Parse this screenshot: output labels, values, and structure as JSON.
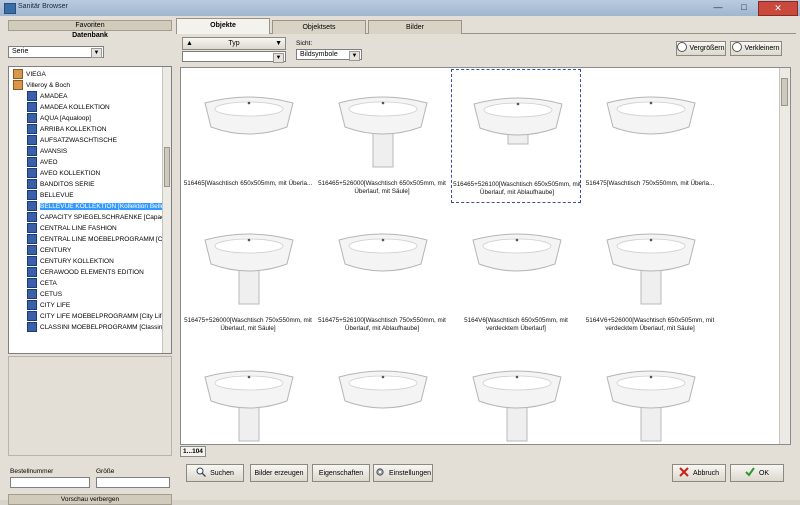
{
  "window": {
    "title": "Sanitär Browser",
    "min": "—",
    "max": "□",
    "close": "✕"
  },
  "colors": {
    "accent": "#3399ff",
    "selection_border": "#3a4ea0",
    "close_red": "#c94a3c"
  },
  "left": {
    "favorites_label": "Favoriten",
    "database_label": "Datenbank",
    "serie_select": "Serie",
    "tree_items": [
      {
        "label": "VIEGA",
        "icon": "lock-icon",
        "level": 0
      },
      {
        "label": "Villeroy & Boch",
        "icon": "lock-icon",
        "level": 0
      },
      {
        "label": "AMADEA",
        "icon": "folder-icon",
        "level": 1
      },
      {
        "label": "AMADEA KOLLEKTION",
        "icon": "folder-icon",
        "level": 1
      },
      {
        "label": "AQUA [Aqualoop]",
        "icon": "folder-icon",
        "level": 1
      },
      {
        "label": "ARRIBA KOLLEKTION",
        "icon": "folder-icon",
        "level": 1
      },
      {
        "label": "AUFSATZWASCHTISCHE",
        "icon": "folder-icon",
        "level": 1
      },
      {
        "label": "AVANSIS",
        "icon": "folder-icon",
        "level": 1
      },
      {
        "label": "AVEO",
        "icon": "folder-icon",
        "level": 1
      },
      {
        "label": "AVEO KOLLEKTION",
        "icon": "folder-icon",
        "level": 1
      },
      {
        "label": "BANDITOS SERIE",
        "icon": "folder-icon",
        "level": 1
      },
      {
        "label": "BELLEVUE",
        "icon": "folder-icon",
        "level": 1
      },
      {
        "label": "BELLEVUE KOLLEKTION [Kollektion Bellevu",
        "icon": "folder-icon",
        "level": 1,
        "selected": true
      },
      {
        "label": "CAPACITY SPIEGELSCHRAENKE [Capacity",
        "icon": "folder-icon",
        "level": 1
      },
      {
        "label": "CENTRAL LINE FASHION",
        "icon": "folder-icon",
        "level": 1
      },
      {
        "label": "CENTRAL LINE MOEBELPROGRAMM [Cent",
        "icon": "folder-icon",
        "level": 1
      },
      {
        "label": "CENTURY",
        "icon": "folder-icon",
        "level": 1
      },
      {
        "label": "CENTURY KOLLEKTION",
        "icon": "folder-icon",
        "level": 1
      },
      {
        "label": "CERAWOOD ELEMENTS EDITION",
        "icon": "folder-icon",
        "level": 1
      },
      {
        "label": "CETA",
        "icon": "folder-icon",
        "level": 1
      },
      {
        "label": "CETUS",
        "icon": "folder-icon",
        "level": 1
      },
      {
        "label": "CITY LIFE",
        "icon": "folder-icon",
        "level": 1
      },
      {
        "label": "CITY LIFE MOEBELPROGRAMM [City Life M",
        "icon": "folder-icon",
        "level": 1
      },
      {
        "label": "CLASSINI MOEBELPROGRAMM [Classini Mo",
        "icon": "folder-icon",
        "level": 1
      }
    ],
    "order_number_label": "Bestellnummer",
    "size_label": "Größe",
    "hide_preview_label": "Vorschau verbergen"
  },
  "tabs": [
    {
      "label": "Objekte",
      "active": true
    },
    {
      "label": "Objektsets",
      "active": false
    },
    {
      "label": "Bilder",
      "active": false
    }
  ],
  "toolbar": {
    "type_label": "Typ",
    "view_label": "Sicht:",
    "view_value": "Bildsymbole",
    "zoom_in_label": "Vergrößern",
    "zoom_out_label": "Verkleinern"
  },
  "items": [
    {
      "caption": "516465[Waschtisch  650x505mm,  mit Überla...",
      "kind": "basin"
    },
    {
      "caption": "516465+526000[Waschtisch 650x505mm, mit Überlauf, mit Säule]",
      "kind": "pedestal"
    },
    {
      "caption": "516465+526100[Waschtisch 650x505mm, mit Überlauf, mit Ablaufhaube]",
      "kind": "semi",
      "selected": true
    },
    {
      "caption": "516475[Waschtisch  750x550mm,  mit Überla...",
      "kind": "basin"
    },
    {
      "caption": "516475+526000[Waschtisch 750x550mm, mit Überlauf, mit Säule]",
      "kind": "pedestal"
    },
    {
      "caption": "516475+526100[Waschtisch 750x550mm, mit Überlauf, mit Ablaufhaube]",
      "kind": "basin"
    },
    {
      "caption": "5164V6[Waschtisch 650x505mm, mit verdecktem Überlauf]",
      "kind": "basin"
    },
    {
      "caption": "5164V6+526000[Waschtisch 650x505mm, mit verdecktem Überlauf, mit Säule]",
      "kind": "pedestal"
    },
    {
      "caption": "",
      "kind": "pedestal"
    },
    {
      "caption": "",
      "kind": "basin"
    },
    {
      "caption": "",
      "kind": "pedestal"
    },
    {
      "caption": "",
      "kind": "pedestal"
    }
  ],
  "pager": "1...104",
  "bottom": {
    "search_label": "Suchen",
    "create_images_label": "Bilder erzeugen",
    "properties_label": "Eigenschaften",
    "settings_label": "Einstellungen",
    "cancel_label": "Abbruch",
    "ok_label": "OK"
  }
}
